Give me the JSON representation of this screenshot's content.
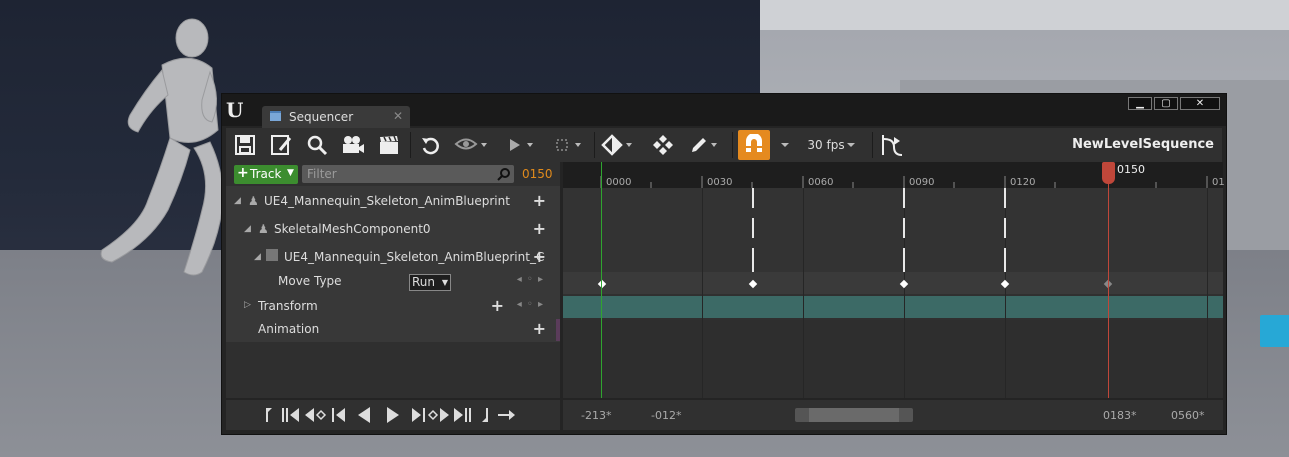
{
  "window": {
    "tab_title": "Sequencer",
    "tab_close": "✕",
    "minimize": "▁",
    "maximize": "▢",
    "close": "✕",
    "sequence_name": "NewLevelSequence"
  },
  "toolbar": {
    "fps_label": "30 fps",
    "icons": [
      "save-icon",
      "save-as-icon",
      "find-icon",
      "camera-icon",
      "clapper-icon",
      "undo-icon",
      "eye-icon",
      "play-icon",
      "selection-icon",
      "key-icon",
      "transform-icon",
      "pen-icon",
      "snap-magnet-icon",
      "curve-editor-icon"
    ]
  },
  "tree": {
    "add_track_label": "Track",
    "filter_placeholder": "Filter",
    "current_frame": "0150",
    "rows": [
      {
        "label": "UE4_Mannequin_Skeleton_AnimBlueprint"
      },
      {
        "label": "SkeletalMeshComponent0"
      },
      {
        "label": "UE4_Mannequin_Skeleton_AnimBlueprint_C"
      },
      {
        "label": "Move Type",
        "value": "Run"
      },
      {
        "label": "Transform"
      },
      {
        "label": "Animation"
      }
    ]
  },
  "timeline": {
    "ticks": [
      "0000",
      "0030",
      "0060",
      "0090",
      "0120",
      "01"
    ],
    "playhead_label": "0150"
  },
  "range": {
    "view_start": "-213*",
    "working_start": "-012*",
    "working_end": "0183*",
    "view_end": "0560*"
  },
  "colors": {
    "accent_orange": "#e58a1f",
    "add_track_green": "#3c8d2f",
    "playhead_red": "#c0473a",
    "transform_lane": "#3c6a66"
  }
}
